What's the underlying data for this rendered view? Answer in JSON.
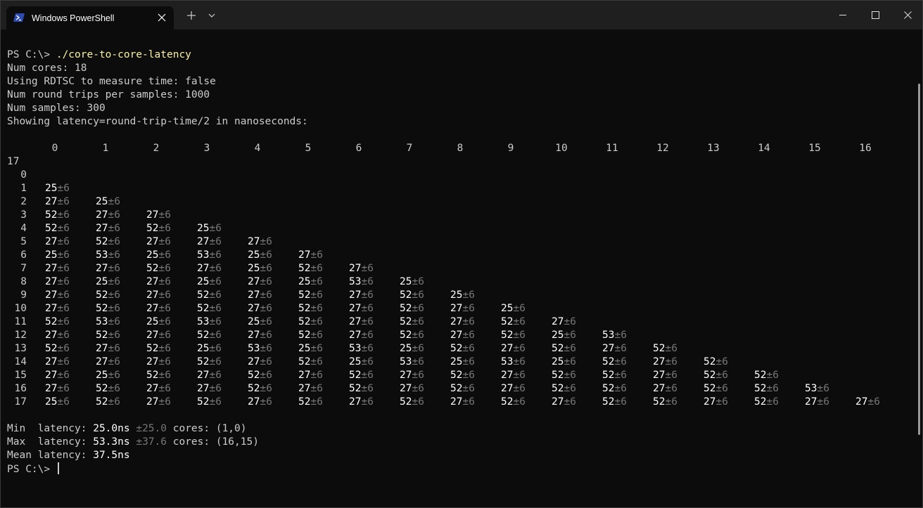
{
  "tab": {
    "title": "Windows PowerShell",
    "icon": "powershell-icon",
    "accent": "#2e4ab3"
  },
  "console": {
    "prompt": "PS C:\\> ",
    "command": "./core-to-core-latency",
    "info_lines": [
      "Num cores: 18",
      "Using RDTSC to measure time: false",
      "Num round trips per samples: 1000",
      "Num samples: 300",
      "Showing latency=round-trip-time/2 in nanoseconds:"
    ],
    "column_headers": [
      "0",
      "1",
      "2",
      "3",
      "4",
      "5",
      "6",
      "7",
      "8",
      "9",
      "10",
      "11",
      "12",
      "13",
      "14",
      "15",
      "16"
    ],
    "wrapped_header": "17",
    "row_labels": [
      "0",
      "1",
      "2",
      "3",
      "4",
      "5",
      "6",
      "7",
      "8",
      "9",
      "10",
      "11",
      "12",
      "13",
      "14",
      "15",
      "16",
      "17"
    ],
    "uncertainty": "±6",
    "matrix": [
      [],
      [
        "25"
      ],
      [
        "27",
        "25"
      ],
      [
        "52",
        "27",
        "27"
      ],
      [
        "52",
        "27",
        "52",
        "25"
      ],
      [
        "27",
        "52",
        "27",
        "27",
        "27"
      ],
      [
        "25",
        "53",
        "25",
        "53",
        "25",
        "27"
      ],
      [
        "27",
        "27",
        "52",
        "27",
        "25",
        "52",
        "27"
      ],
      [
        "27",
        "25",
        "27",
        "25",
        "27",
        "25",
        "53",
        "25"
      ],
      [
        "27",
        "52",
        "27",
        "52",
        "27",
        "52",
        "27",
        "52",
        "25"
      ],
      [
        "27",
        "52",
        "27",
        "52",
        "27",
        "52",
        "27",
        "52",
        "27",
        "25"
      ],
      [
        "52",
        "53",
        "25",
        "53",
        "25",
        "52",
        "27",
        "52",
        "27",
        "52",
        "27"
      ],
      [
        "27",
        "52",
        "27",
        "52",
        "27",
        "52",
        "27",
        "52",
        "27",
        "52",
        "25",
        "53"
      ],
      [
        "52",
        "27",
        "52",
        "25",
        "53",
        "25",
        "53",
        "25",
        "52",
        "27",
        "52",
        "27",
        "52"
      ],
      [
        "27",
        "27",
        "27",
        "52",
        "27",
        "52",
        "25",
        "53",
        "25",
        "53",
        "25",
        "52",
        "27",
        "52"
      ],
      [
        "27",
        "25",
        "52",
        "27",
        "52",
        "27",
        "52",
        "27",
        "52",
        "27",
        "52",
        "52",
        "27",
        "52",
        "52"
      ],
      [
        "27",
        "52",
        "27",
        "27",
        "52",
        "27",
        "52",
        "27",
        "52",
        "27",
        "52",
        "52",
        "27",
        "52",
        "52",
        "53"
      ],
      [
        "25",
        "52",
        "27",
        "52",
        "27",
        "52",
        "27",
        "52",
        "27",
        "52",
        "27",
        "52",
        "52",
        "27",
        "52",
        "27",
        "27"
      ]
    ],
    "summary": {
      "min": {
        "label": "Min  latency: ",
        "value": "25.0ns",
        "err": "±25.0",
        "cores": " cores: (1,0)"
      },
      "max": {
        "label": "Max  latency: ",
        "value": "53.3ns",
        "err": "±37.6",
        "cores": " cores: (16,15)"
      },
      "mean": {
        "label": "Mean latency: ",
        "value": "37.5ns"
      }
    }
  }
}
